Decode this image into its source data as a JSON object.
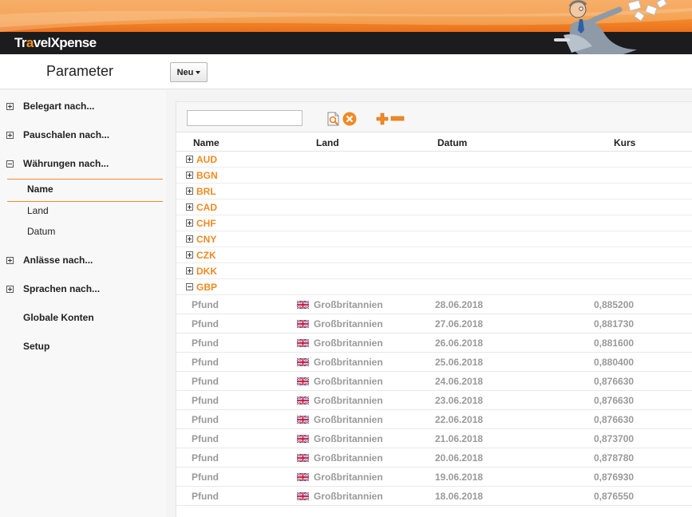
{
  "app": {
    "logo_pre": "Tr",
    "logo_o": "a",
    "logo_post": "velXpense"
  },
  "header": {
    "title": "Parameter",
    "new_button": "Neu"
  },
  "sidebar": {
    "groups": [
      {
        "label": "Belegart nach...",
        "expanded": false
      },
      {
        "label": "Pauschalen nach...",
        "expanded": false
      },
      {
        "label": "Währungen nach...",
        "expanded": true,
        "children": [
          "Name",
          "Land",
          "Datum"
        ],
        "active_child": "Name"
      },
      {
        "label": "Anlässe nach...",
        "expanded": false
      },
      {
        "label": "Sprachen nach...",
        "expanded": false
      }
    ],
    "plain_items": [
      "Globale Konten",
      "Setup"
    ]
  },
  "toolbar": {
    "search_value": ""
  },
  "table": {
    "columns": [
      "Name",
      "Land",
      "Datum",
      "Kurs"
    ],
    "groups": [
      "AUD",
      "BGN",
      "BRL",
      "CAD",
      "CHF",
      "CNY",
      "CZK",
      "DKK",
      "GBP"
    ],
    "expanded_group": "GBP",
    "rows": [
      {
        "name": "Pfund",
        "land": "Großbritannien",
        "datum": "28.06.2018",
        "kurs": "0,885200"
      },
      {
        "name": "Pfund",
        "land": "Großbritannien",
        "datum": "27.06.2018",
        "kurs": "0,881730"
      },
      {
        "name": "Pfund",
        "land": "Großbritannien",
        "datum": "26.06.2018",
        "kurs": "0,881600"
      },
      {
        "name": "Pfund",
        "land": "Großbritannien",
        "datum": "25.06.2018",
        "kurs": "0,880400"
      },
      {
        "name": "Pfund",
        "land": "Großbritannien",
        "datum": "24.06.2018",
        "kurs": "0,876630"
      },
      {
        "name": "Pfund",
        "land": "Großbritannien",
        "datum": "23.06.2018",
        "kurs": "0,876630"
      },
      {
        "name": "Pfund",
        "land": "Großbritannien",
        "datum": "22.06.2018",
        "kurs": "0,876630"
      },
      {
        "name": "Pfund",
        "land": "Großbritannien",
        "datum": "21.06.2018",
        "kurs": "0,873700"
      },
      {
        "name": "Pfund",
        "land": "Großbritannien",
        "datum": "20.06.2018",
        "kurs": "0,878780"
      },
      {
        "name": "Pfund",
        "land": "Großbritannien",
        "datum": "19.06.2018",
        "kurs": "0,876930"
      },
      {
        "name": "Pfund",
        "land": "Großbritannien",
        "datum": "18.06.2018",
        "kurs": "0,876550"
      }
    ]
  },
  "colors": {
    "accent": "#f08a23",
    "header_dark": "#1c1c1e",
    "muted_text": "#9a9a9a"
  },
  "icons": {
    "toolbar": [
      "search-page-icon",
      "clear-icon",
      "expand-all-icon",
      "collapse-all-icon"
    ],
    "row_flag": "uk-flag-icon"
  }
}
